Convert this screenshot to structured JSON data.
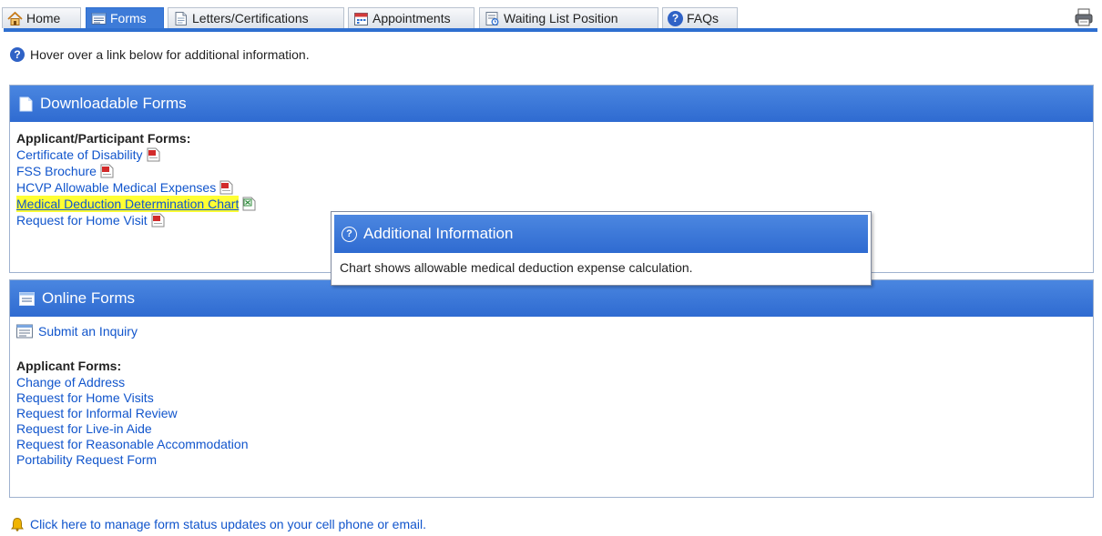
{
  "tabs": [
    {
      "label": "Home",
      "icon": "home-icon"
    },
    {
      "label": "Forms",
      "icon": "form-icon"
    },
    {
      "label": "Letters/Certifications",
      "icon": "document-icon"
    },
    {
      "label": "Appointments",
      "icon": "calendar-icon"
    },
    {
      "label": "Waiting List Position",
      "icon": "list-icon"
    },
    {
      "label": "FAQs",
      "icon": "help-icon"
    }
  ],
  "active_tab": "Forms",
  "hint": {
    "text": "Hover over a link below for additional information.",
    "icon": "help-icon"
  },
  "downloadable": {
    "title": "Downloadable Forms",
    "icon": "document-icon",
    "subheading": "Applicant/Participant Forms:",
    "items": [
      {
        "label": "Certificate of Disability",
        "file_icon": "pdf-icon"
      },
      {
        "label": "FSS Brochure",
        "file_icon": "pdf-icon"
      },
      {
        "label": "HCVP Allowable Medical Expenses",
        "file_icon": "pdf-icon"
      },
      {
        "label": "Medical Deduction Determination Chart",
        "file_icon": "excel-icon"
      },
      {
        "label": "Request for Home Visit",
        "file_icon": "pdf-icon"
      }
    ]
  },
  "tooltip": {
    "title": "Additional Information",
    "text": "Chart shows allowable medical deduction expense calculation."
  },
  "online": {
    "title": "Online Forms",
    "icon": "form-icon",
    "inquiry_label": "Submit an Inquiry",
    "subheading": "Applicant Forms:",
    "items": [
      "Change of Address",
      "Request for Home Visits",
      "Request for Informal Review",
      "Request for Live-in Aide",
      "Request for Reasonable Accommodation",
      "Portability Request Form"
    ]
  },
  "footer": {
    "text": "Click here to manage form status updates on your cell phone or email.",
    "icon": "bell-icon"
  },
  "colors": {
    "tab_accent": "#2e6fd0",
    "header_blue": "#3878d8",
    "link": "#1155cc",
    "highlight": "#ffff33"
  }
}
